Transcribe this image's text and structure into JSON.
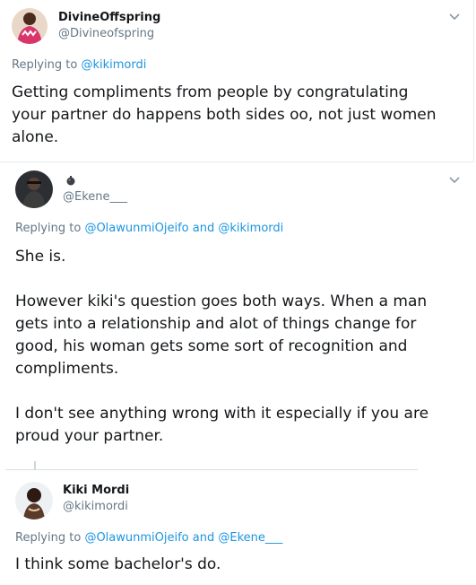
{
  "tweets": [
    {
      "name": "DivineOffspring",
      "handle": "@Divineofspring",
      "replying_prefix": "Replying to",
      "replying_to": [
        "@kikimordi"
      ],
      "replying_join": "",
      "body_lines": [
        "Getting compliments from people by congratulating",
        "your partner do happens both sides oo, not just women",
        "alone."
      ]
    },
    {
      "name": "",
      "handle": "@Ekene___",
      "replying_prefix": "Replying to",
      "replying_to": [
        "@OlawunmiOjeifo",
        "@kikimordi"
      ],
      "replying_join": "and",
      "body_lines": [
        "She is.",
        "",
        "However kiki's question goes both ways. When a man",
        "gets into a relationship and alot of things change for",
        "good, his woman gets some sort of recognition and",
        "compliments.",
        "",
        "I don't see anything wrong with it especially if you are",
        "proud your partner."
      ]
    },
    {
      "name": "Kiki Mordi",
      "handle": "@kikimordi",
      "replying_prefix": "Replying to",
      "replying_to": [
        "@OlawunmiOjeifo",
        "@Ekene___"
      ],
      "replying_join": "and",
      "body_lines": [
        "I think some bachelor's do."
      ]
    }
  ],
  "icons": {
    "more": "chevron-down-icon",
    "name_emoji": "bomb-icon"
  },
  "colors": {
    "link": "#1b95e0",
    "secondary_text": "#657786",
    "primary_text": "#14171a",
    "border": "#e6ecf0",
    "thread_line": "#ccd6dd"
  }
}
